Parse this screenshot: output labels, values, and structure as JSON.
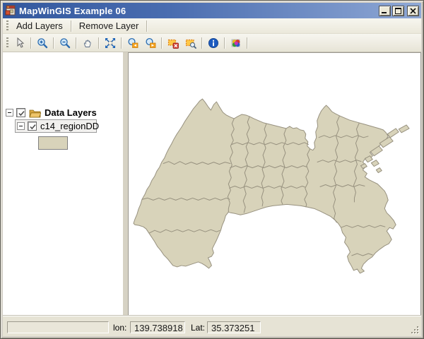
{
  "window": {
    "title": "MapWinGIS Example 06"
  },
  "menu": {
    "items": [
      {
        "label": "Add Layers"
      },
      {
        "label": "Remove Layer"
      }
    ]
  },
  "toolbar": {
    "buttons": [
      {
        "name": "select-pointer"
      },
      {
        "name": "zoom-in"
      },
      {
        "name": "zoom-out"
      },
      {
        "name": "pan"
      },
      {
        "name": "zoom-full-extent"
      },
      {
        "name": "zoom-previous"
      },
      {
        "name": "zoom-next"
      },
      {
        "name": "clear-selection"
      },
      {
        "name": "zoom-to-selection"
      },
      {
        "name": "identify-info"
      },
      {
        "name": "symbology-colors"
      }
    ]
  },
  "layers_panel": {
    "root_label": "Data Layers",
    "root_checked": true,
    "layer_label": "c14_regionDD",
    "layer_checked": true,
    "swatch_color": "#D8D3BA"
  },
  "statusbar": {
    "lon_label": "lon:",
    "lon_value": "139.738918",
    "lat_label": "Lat:",
    "lat_value": "35.373251"
  },
  "colors": {
    "titlebar_left": "#33589E",
    "titlebar_right": "#8FA8D5",
    "map_fill": "#D8D3BA",
    "map_stroke": "#97917F",
    "chrome": "#ECE9DB"
  }
}
